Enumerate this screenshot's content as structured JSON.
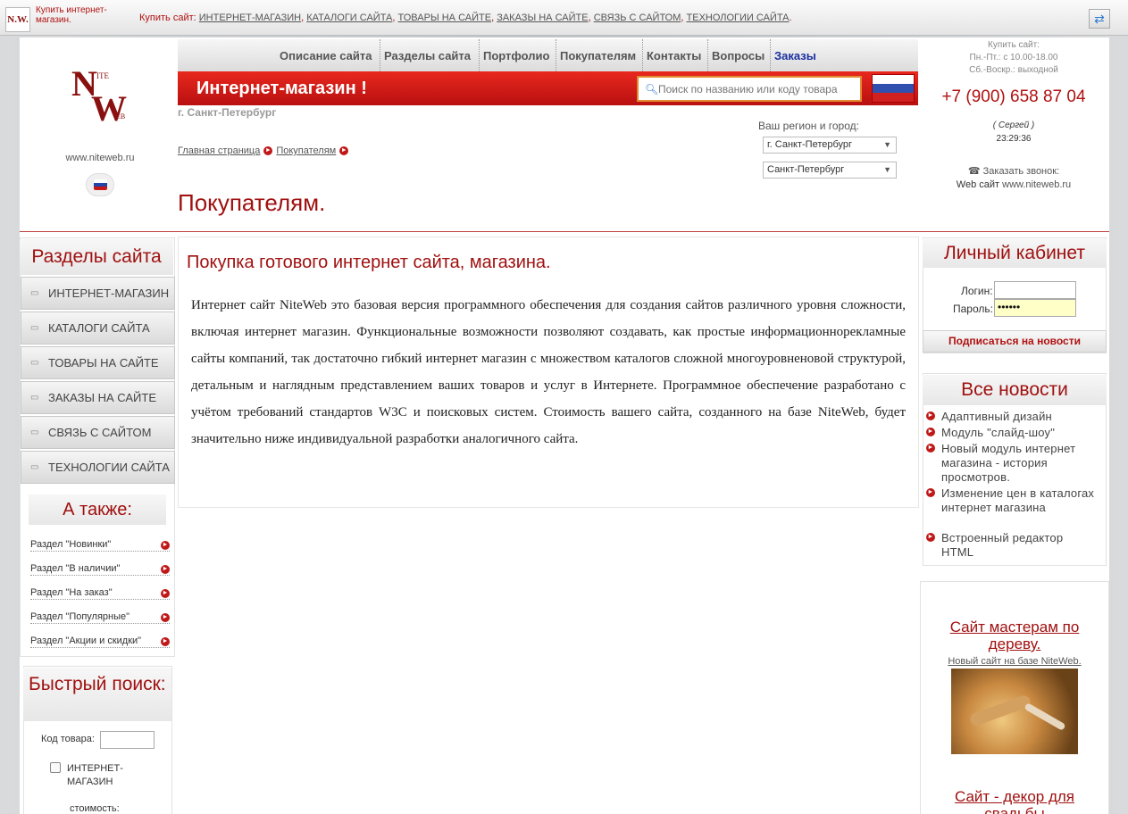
{
  "topbar": {
    "logo_text": "N.W.",
    "text": "Купить интернет-магазин.",
    "buy_label": "Купить сайт:",
    "links": [
      "ИНТЕРНЕТ-МАГАЗИН",
      "КАТАЛОГИ САЙТА",
      "ТОВАРЫ НА САЙТЕ",
      "ЗАКАЗЫ НА САЙТЕ",
      "СВЯЗЬ С САЙТОМ",
      "ТЕХНОЛОГИИ САЙТА"
    ],
    "arrow_icon": "⇄"
  },
  "header": {
    "logo": {
      "n": "N",
      "ite": "ITE",
      "w": "W",
      "eb": "EB"
    },
    "url": "www.niteweb.ru",
    "nav": [
      "Описание сайта",
      "Разделы сайта",
      "Портфолио",
      "Покупателям",
      "Контакты",
      "Вопросы",
      "Заказы"
    ],
    "banner_title": "Интернет-магазин !",
    "search_placeholder": "Поиск по названию или коду товара",
    "city": "г. Санкт-Петербург",
    "breadcrumbs": [
      "Главная страница",
      "Покупателям"
    ],
    "region_label": "Ваш регион и город:",
    "region_select": "г. Санкт-Петербург",
    "city_select": "Санкт-Петербург",
    "page_title": "Покупателям."
  },
  "contacts": {
    "buy": "Купить сайт:",
    "hours1": "Пн.-Пт.: с 10.00-18.00",
    "hours2": "Сб.-Воскр.: выходной",
    "phone": "+7 (900) 658 87 04",
    "manager": "( Сергей )",
    "time": "23:29:36",
    "callback": "Заказать звонок:",
    "phone_icon": "☎",
    "web_label": "Web сайт",
    "web_url": "www.niteweb.ru"
  },
  "sidebar": {
    "title": "Разделы сайта",
    "sections": [
      "ИНТЕРНЕТ-МАГАЗИН",
      "КАТАЛОГИ САЙТА",
      "ТОВАРЫ НА САЙТЕ",
      "ЗАКАЗЫ НА САЙТЕ",
      "СВЯЗЬ С САЙТОМ",
      "ТЕХНОЛОГИИ САЙТА"
    ],
    "also_title": "А также:",
    "also": [
      "Раздел \"Новинки\"",
      "Раздел \"В наличии\"",
      "Раздел \"На заказ\"",
      "Раздел \"Популярные\"",
      "Раздел \"Акции и скидки\""
    ],
    "quick_title": "Быстрый поиск:",
    "code_label": "Код товара:",
    "check_label": "ИНТЕРНЕТ-МАГАЗИН",
    "cost_label": "стоимость:"
  },
  "main": {
    "title": "Покупка готового интернет сайта, магазина.",
    "text": "Интернет сайт NiteWeb это базовая версия программного обеспечения для создания сайтов различного уровня сложности, включая интернет магазин. Функциональные возможности позволяют создавать, как простые информационнорекламные сайты компаний, так достаточно гибкий интернет магазин с множеством каталогов сложной многоуровненовой структурой, детальным и наглядным представлением ваших товаров и услуг в Интернете. Программное обеспечение разработано с учётом требований стандартов W3C и поисковых систем. Стоимость вашего сайта, созданного на базе NiteWeb, будет значительно ниже индивидуальной разработки аналогичного сайта."
  },
  "cabinet": {
    "title": "Личный кабинет",
    "login_label": "Логин:",
    "password_label": "Пароль:",
    "password_value": "••••••",
    "subscribe": "Подписаться на новости"
  },
  "news": {
    "title": "Все новости",
    "items": [
      "Адаптивный дизайн",
      "Модуль \"слайд-шоу\"",
      "Новый модуль интернет магазина - история просмотров.",
      "Изменение цен в каталогах интернет магазина",
      "Встроенный редактор HTML"
    ]
  },
  "promo": {
    "title1": "Сайт мастерам по дереву.",
    "sub1": "Новый сайт на базе NiteWeb.",
    "title2": "Сайт - декор для свадьбы"
  }
}
